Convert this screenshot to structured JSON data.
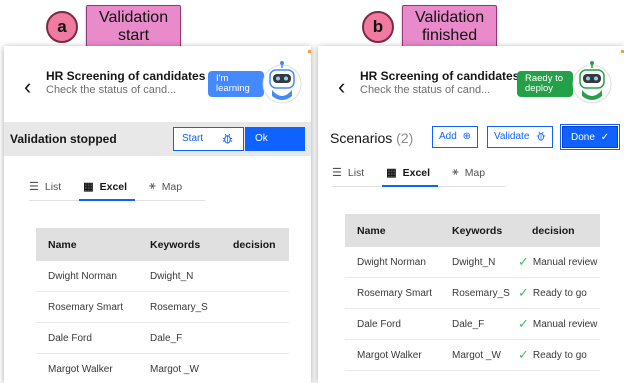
{
  "step_a": {
    "letter": "a",
    "label_line1": "Validation",
    "label_line2": "start"
  },
  "step_b": {
    "letter": "b",
    "label_line1": "Validation",
    "label_line2": "finished"
  },
  "panel_a": {
    "back_icon": "chevron-left-icon",
    "title": "HR Screening of candidates",
    "subtitle": "Check the status of cand...",
    "robot_message_line1": "I'm",
    "robot_message_line2": "learning",
    "robot_color": "#4589ff",
    "status_text": "Validation stopped",
    "start_label": "Start",
    "start_icon": "bug-icon",
    "ok_label": "Ok",
    "tabs": [
      {
        "icon": "list-icon",
        "label": "List",
        "active": false
      },
      {
        "icon": "table-icon",
        "label": "Excel",
        "active": true
      },
      {
        "icon": "tree-map-icon",
        "label": "Map",
        "active": false
      }
    ],
    "table": {
      "headers": [
        "Name",
        "Keywords",
        "decision"
      ],
      "rows": [
        {
          "name": "Dwight Norman",
          "keyword": "Dwight_N",
          "decision": ""
        },
        {
          "name": "Rosemary Smart",
          "keyword": "Rosemary_S",
          "decision": ""
        },
        {
          "name": "Dale Ford",
          "keyword": "Dale_F",
          "decision": ""
        },
        {
          "name": "Margot Walker",
          "keyword": "Margot _W",
          "decision": ""
        }
      ]
    }
  },
  "panel_b": {
    "back_icon": "chevron-left-icon",
    "title": "HR Screening of candidates",
    "subtitle": "Check the status of cand...",
    "robot_message_line1": "Raedy to",
    "robot_message_line2": "deploy",
    "robot_color": "#24a148",
    "scenarios_label": "Scenarios",
    "scenarios_count": "(2)",
    "add_label": "Add",
    "validate_label": "Validate",
    "done_label": "Done",
    "tabs": [
      {
        "icon": "list-icon",
        "label": "List",
        "active": false
      },
      {
        "icon": "table-icon",
        "label": "Excel",
        "active": true
      },
      {
        "icon": "tree-map-icon",
        "label": "Map",
        "active": false
      }
    ],
    "table": {
      "headers": [
        "Name",
        "Keywords",
        "decision"
      ],
      "rows": [
        {
          "name": "Dwight Norman",
          "keyword": "Dwight_N",
          "decision": "Manual review"
        },
        {
          "name": "Rosemary Smart",
          "keyword": "Rosemary_S",
          "decision": "Ready to go"
        },
        {
          "name": "Dale Ford",
          "keyword": "Dale_F",
          "decision": "Manual review"
        },
        {
          "name": "Margot Walker",
          "keyword": "Margot _W",
          "decision": "Ready to go"
        }
      ]
    }
  },
  "colors": {
    "primary": "#0f62fe",
    "badge_pink": "#e98acb",
    "check_green": "#42be65"
  }
}
